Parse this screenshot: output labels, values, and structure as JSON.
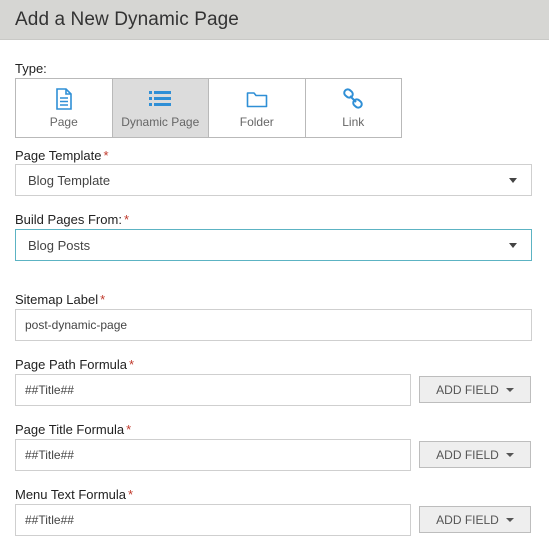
{
  "header": {
    "title": "Add a New Dynamic Page"
  },
  "type": {
    "label": "Type:",
    "options": [
      {
        "label": "Page",
        "icon": "page-icon"
      },
      {
        "label": "Dynamic Page",
        "icon": "list-icon",
        "selected": true
      },
      {
        "label": "Folder",
        "icon": "folder-icon"
      },
      {
        "label": "Link",
        "icon": "link-icon"
      }
    ]
  },
  "page_template": {
    "label": "Page Template",
    "required": "*",
    "value": "Blog Template"
  },
  "build_from": {
    "label": "Build Pages From:",
    "required": "*",
    "value": "Blog Posts"
  },
  "sitemap_label": {
    "label": "Sitemap Label",
    "required": "*",
    "value": "post-dynamic-page"
  },
  "page_path_formula": {
    "label": "Page Path Formula",
    "required": "*",
    "value": "##Title##",
    "add_field": "ADD FIELD"
  },
  "page_title_formula": {
    "label": "Page Title Formula",
    "required": "*",
    "value": "##Title##",
    "add_field": "ADD FIELD"
  },
  "menu_text_formula": {
    "label": "Menu Text Formula",
    "required": "*",
    "value": "##Title##",
    "add_field": "ADD FIELD"
  },
  "colors": {
    "accent": "#5cb3c3",
    "icon_blue": "#2f8fd6",
    "required": "#c0392b",
    "header_bg": "#d6d6d3"
  }
}
